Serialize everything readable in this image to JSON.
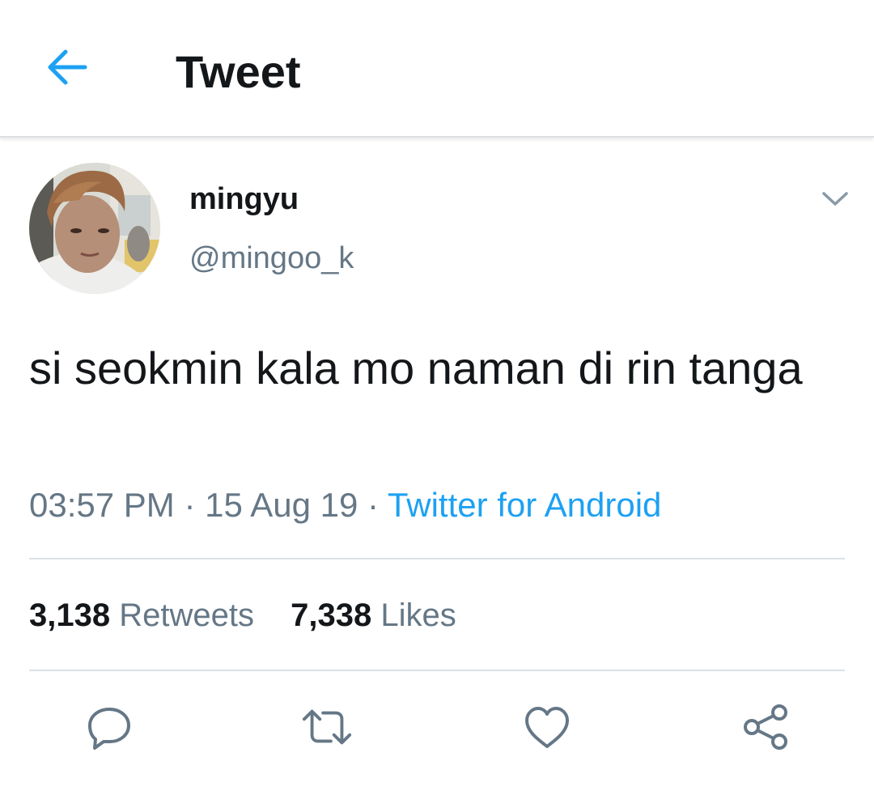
{
  "header": {
    "title": "Tweet",
    "back_icon": "arrow-left-icon",
    "accent_color": "#1da1f2"
  },
  "tweet": {
    "display_name": "mingyu",
    "handle": "@mingoo_k",
    "text": "si seokmin kala mo naman di rin tanga",
    "time": "03:57 PM",
    "date": "15 Aug 19",
    "separator": "·",
    "source": "Twitter for Android",
    "menu_icon": "chevron-down-icon"
  },
  "stats": {
    "retweets_count": "3,138",
    "retweets_label": "Retweets",
    "likes_count": "7,338",
    "likes_label": "Likes"
  },
  "actions": [
    {
      "icon": "reply-icon"
    },
    {
      "icon": "retweet-icon"
    },
    {
      "icon": "heart-icon"
    },
    {
      "icon": "share-icon"
    }
  ]
}
